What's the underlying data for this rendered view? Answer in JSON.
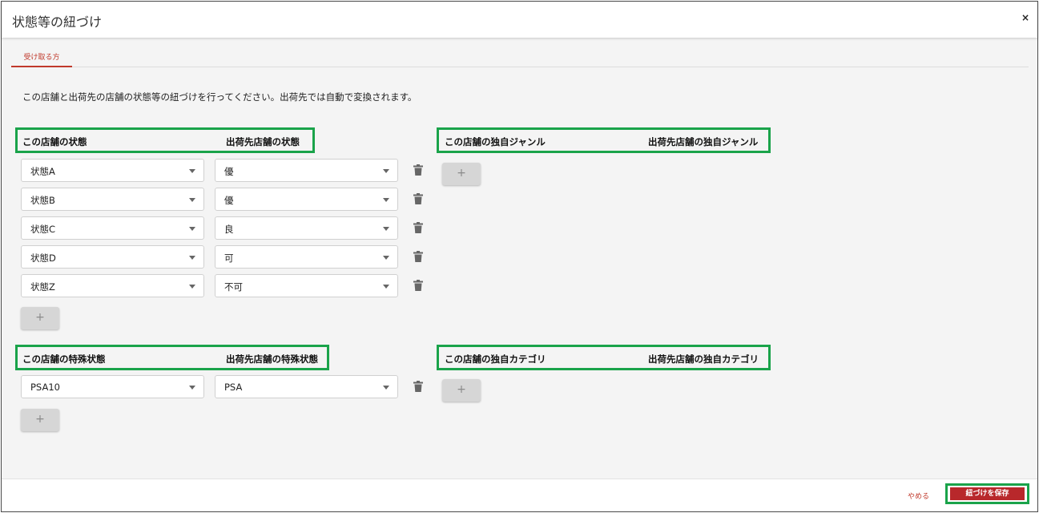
{
  "modal": {
    "title": "状態等の紐づけ",
    "close_label": "×"
  },
  "tabs": [
    {
      "label": "受け取る方"
    }
  ],
  "description": "この店舗と出荷先の店舗の状態等の紐づけを行ってください。出荷先では自動で変換されます。",
  "conditions": {
    "headers": {
      "left": "この店舗の状態",
      "right": "出荷先店舗の状態"
    },
    "rows": [
      {
        "left": "状態A",
        "right": "優"
      },
      {
        "left": "状態B",
        "right": "優"
      },
      {
        "left": "状態C",
        "right": "良"
      },
      {
        "left": "状態D",
        "right": "可"
      },
      {
        "left": "状態Z",
        "right": "不可"
      }
    ],
    "add_label": "+"
  },
  "special_conditions": {
    "headers": {
      "left": "この店舗の特殊状態",
      "right": "出荷先店舗の特殊状態"
    },
    "rows": [
      {
        "left": "PSA10",
        "right": "PSA"
      }
    ],
    "add_label": "+"
  },
  "genres": {
    "headers": {
      "left": "この店舗の独自ジャンル",
      "right": "出荷先店舗の独自ジャンル"
    },
    "add_label": "+"
  },
  "categories": {
    "headers": {
      "left": "この店舗の独自カテゴリ",
      "right": "出荷先店舗の独自カテゴリ"
    },
    "add_label": "+"
  },
  "footer": {
    "cancel_label": "やめる",
    "save_label": "紐づけを保存"
  },
  "colors": {
    "accent": "#b8282b",
    "highlight": "#1aa34a"
  },
  "icons": {
    "delete": "trash-icon",
    "dropdown": "chevron-down-icon"
  }
}
